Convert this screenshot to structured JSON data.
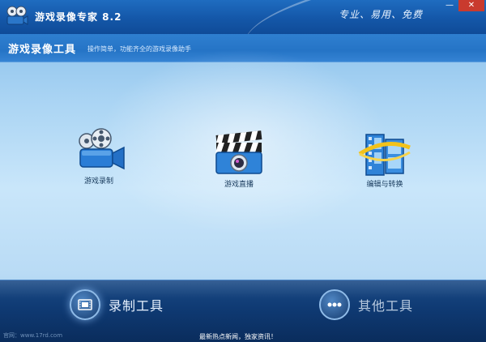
{
  "window": {
    "title": "游戏录像专家 8.2",
    "slogan": "专业、易用、免费",
    "minimize_glyph": "—",
    "close_glyph": "✕"
  },
  "subheader": {
    "title": "游戏录像工具",
    "description": "操作简单，功能齐全的游戏录像助手"
  },
  "tools": [
    {
      "label": "游戏录制",
      "icon": "film-camera-icon"
    },
    {
      "label": "游戏直播",
      "icon": "clapperboard-icon"
    },
    {
      "label": "编辑与转换",
      "icon": "film-strip-icon"
    }
  ],
  "bottom": {
    "record_tools": "录制工具",
    "other_tools": "其他工具"
  },
  "footer": {
    "site": "官网：www.17rd.com",
    "news": "最新热点新闻，独家资讯！"
  },
  "colors": {
    "titlebar": "#1457a8",
    "subheader": "#2574c6",
    "bottombar": "#0f3a73",
    "close": "#c93a2e"
  }
}
